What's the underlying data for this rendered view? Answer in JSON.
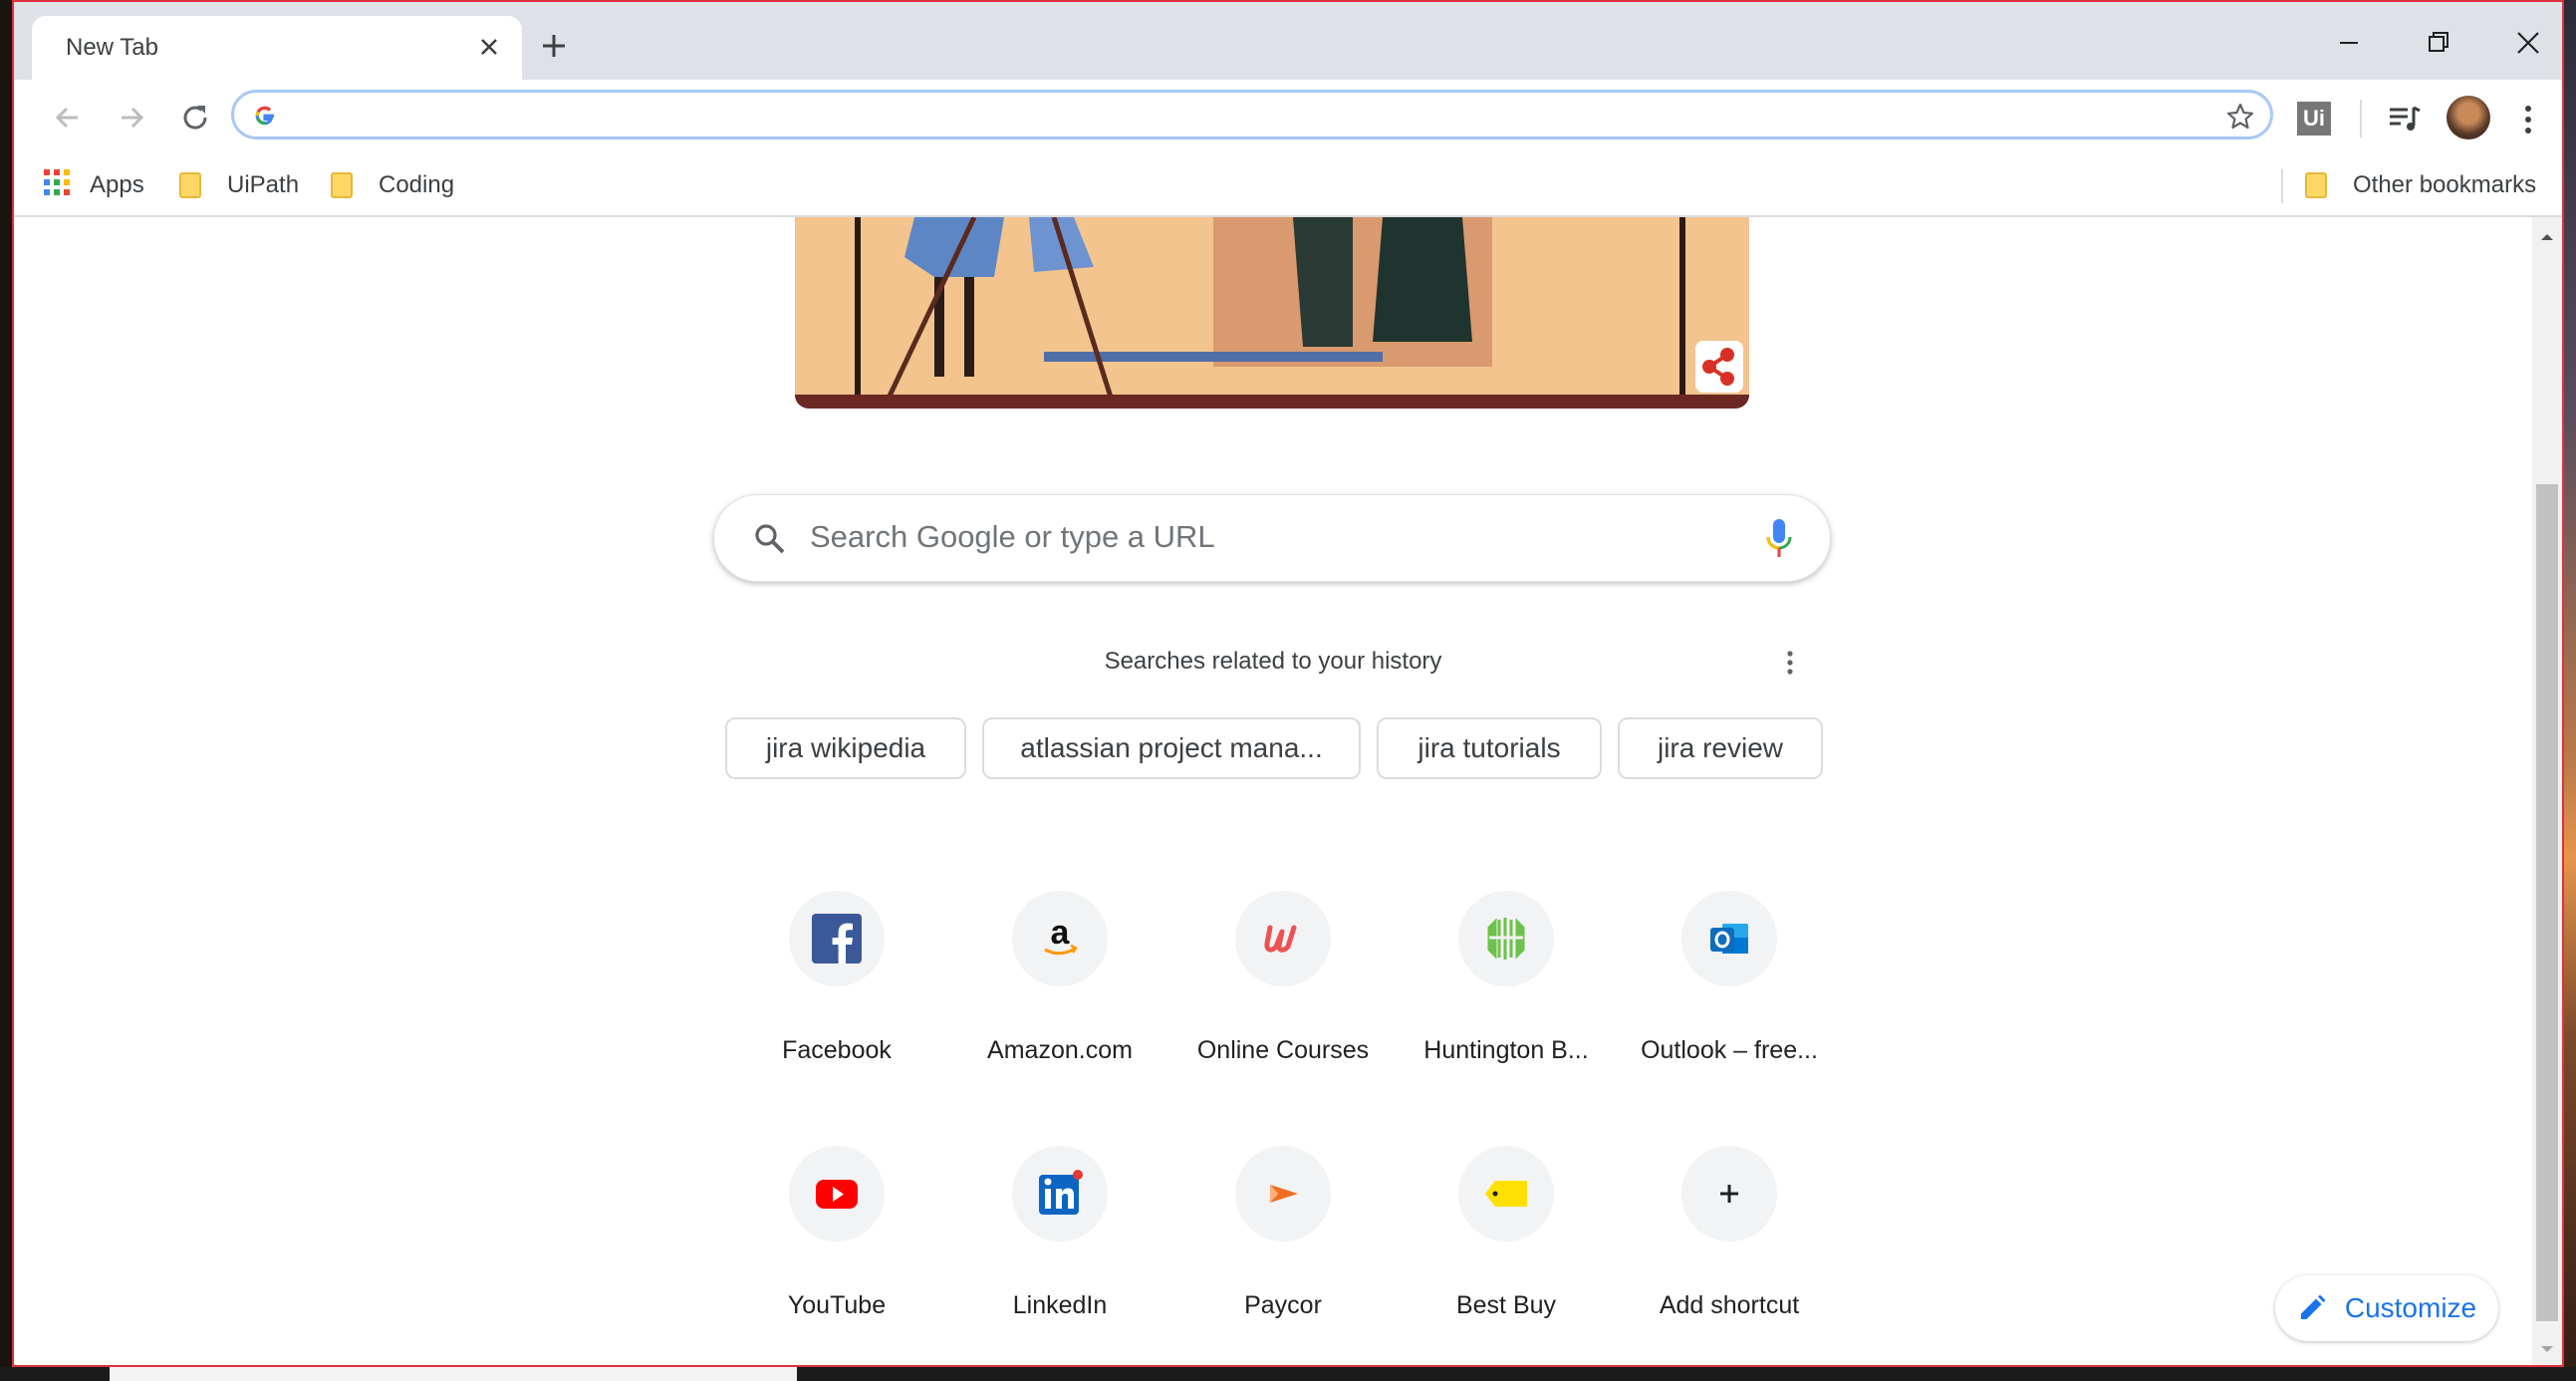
{
  "tabs": [
    {
      "title": "New Tab"
    }
  ],
  "toolbar": {
    "omnibox_value": ""
  },
  "bookmarks": {
    "items": [
      {
        "label": "Apps"
      },
      {
        "label": "UiPath"
      },
      {
        "label": "Coding"
      }
    ],
    "other": "Other bookmarks"
  },
  "ntp": {
    "search_placeholder": "Search Google or type a URL",
    "related_title": "Searches related to your history",
    "related_chips": [
      "jira wikipedia",
      "atlassian project mana...",
      "jira tutorials",
      "jira review"
    ],
    "shortcuts": [
      {
        "label": "Facebook",
        "icon": "facebook-icon"
      },
      {
        "label": "Amazon.com",
        "icon": "amazon-icon"
      },
      {
        "label": "Online Courses",
        "icon": "udemy-icon"
      },
      {
        "label": "Huntington B...",
        "icon": "huntington-icon"
      },
      {
        "label": "Outlook – free...",
        "icon": "outlook-icon"
      },
      {
        "label": "YouTube",
        "icon": "youtube-icon"
      },
      {
        "label": "LinkedIn",
        "icon": "linkedin-icon"
      },
      {
        "label": "Paycor",
        "icon": "paycor-icon"
      },
      {
        "label": "Best Buy",
        "icon": "bestbuy-icon"
      },
      {
        "label": "Add shortcut",
        "icon": "plus-icon"
      }
    ],
    "customize_label": "Customize"
  },
  "colors": {
    "accent": "#1a73e8",
    "tabstrip": "#dee1e6",
    "focus_ring": "#a8c7fa"
  }
}
